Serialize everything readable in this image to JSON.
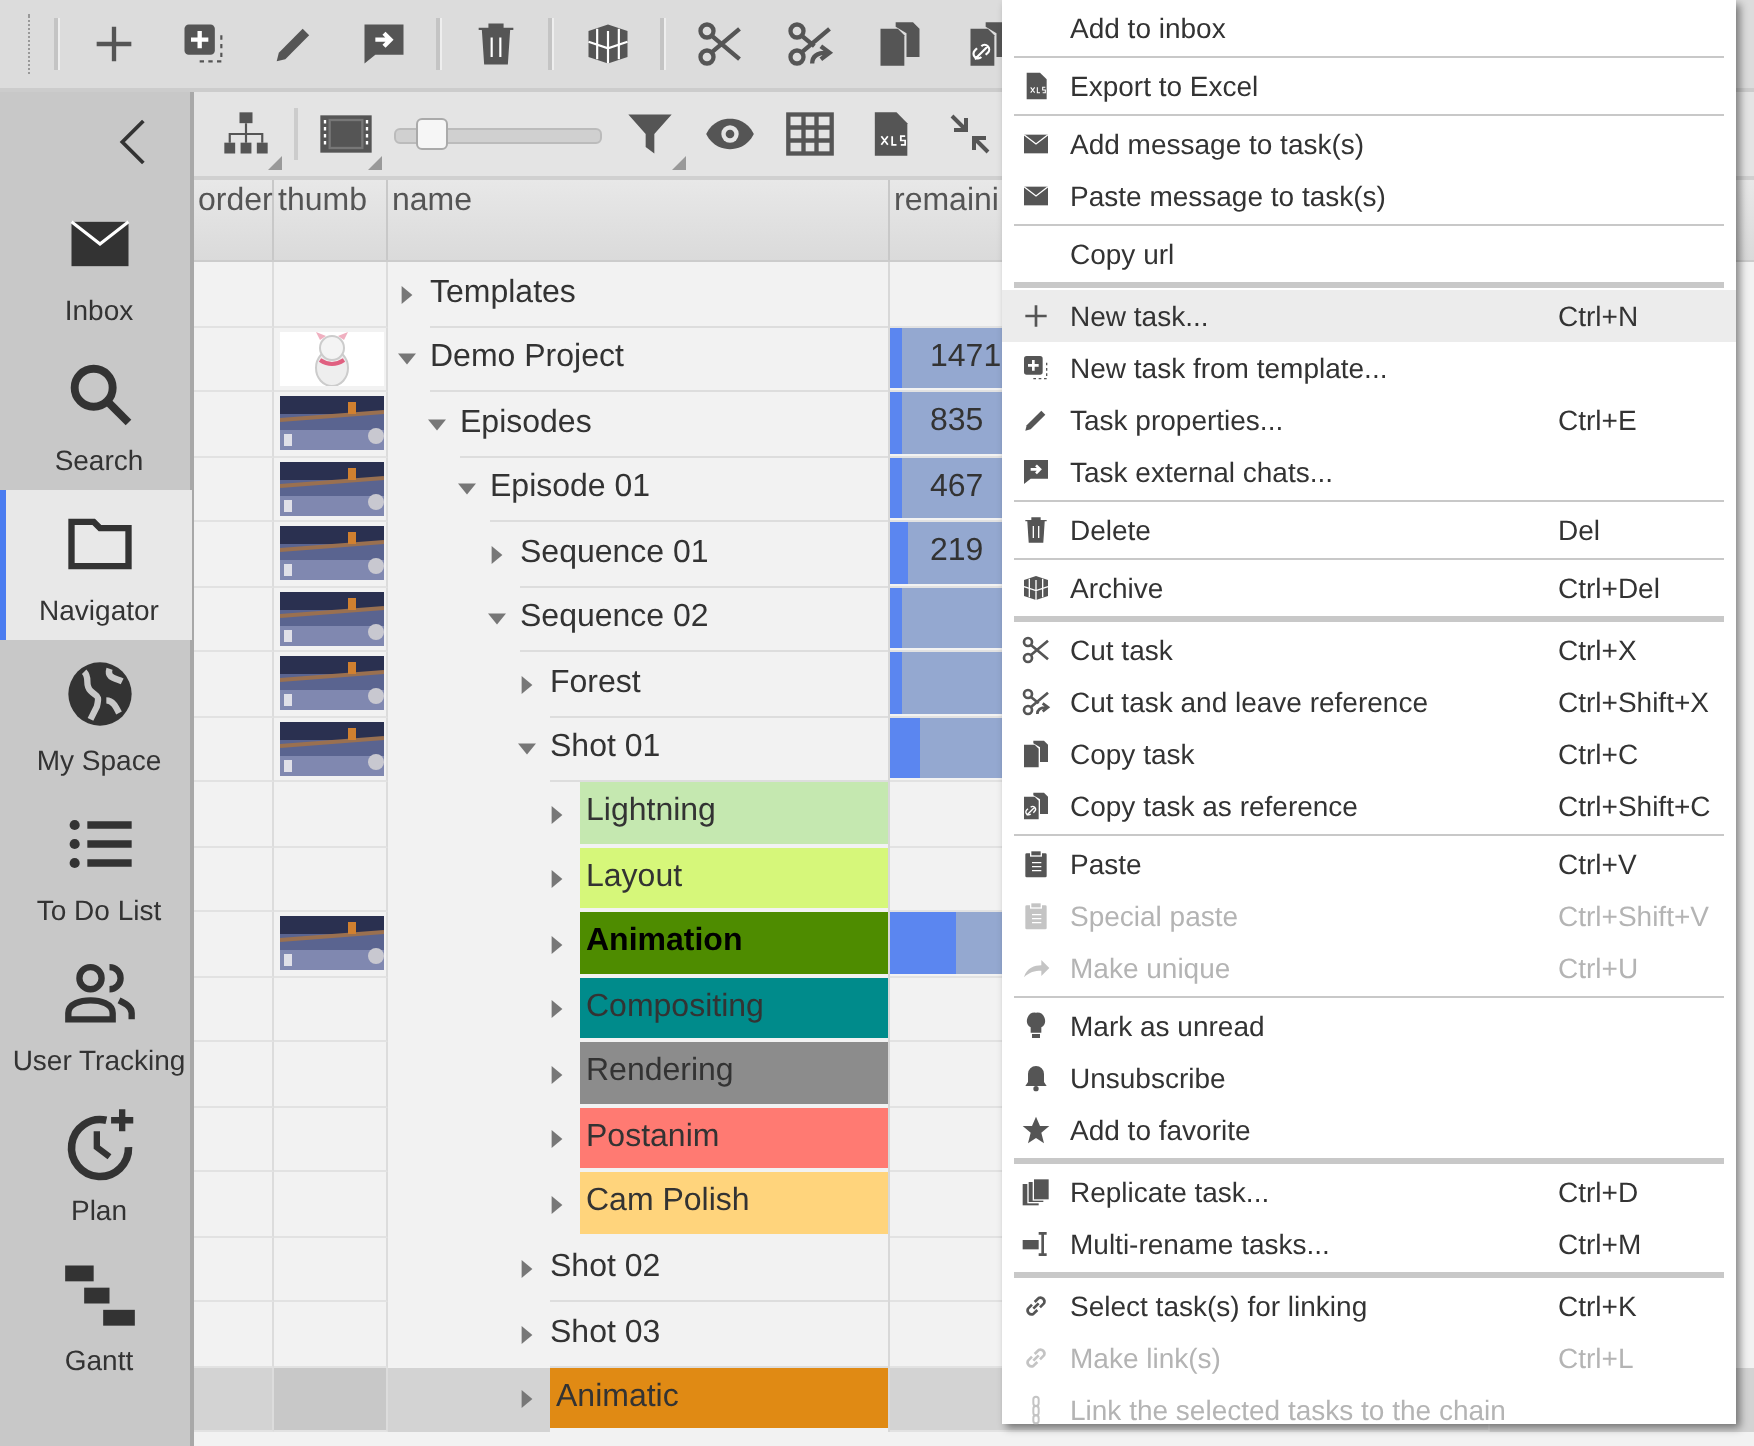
{
  "sidebar": {
    "items": [
      {
        "label": "Inbox",
        "selected": false
      },
      {
        "label": "Search",
        "selected": false
      },
      {
        "label": "Navigator",
        "selected": true
      },
      {
        "label": "My Space",
        "selected": false
      },
      {
        "label": "To Do List",
        "selected": false
      },
      {
        "label": "User Tracking",
        "selected": false
      },
      {
        "label": "Plan",
        "selected": false
      },
      {
        "label": "Gantt",
        "selected": false
      }
    ]
  },
  "view_toolbar": {
    "zoom_slider": {
      "level": 0.12
    }
  },
  "tree": {
    "columns": [
      "order",
      "thumb",
      "name",
      "remaini"
    ],
    "rows": [
      {
        "name": "Templates",
        "expanded": false,
        "selected": false
      },
      {
        "name": "Demo Project",
        "expanded": true,
        "selected": false,
        "thumbnail": {
          "kind": "picture"
        },
        "remaining": "1471",
        "level": 0.02,
        "children": [
          {
            "name": "Episodes",
            "expanded": true,
            "selected": false,
            "thumbnail": {
              "kind": "picture"
            },
            "remaining": "835",
            "level": 0.02,
            "children": [
              {
                "name": "Episode 01",
                "expanded": true,
                "selected": false,
                "thumbnail": {
                  "kind": "picture"
                },
                "remaining": "467",
                "level": 0.02,
                "children": [
                  {
                    "name": "Sequence 01",
                    "expanded": false,
                    "selected": false,
                    "thumbnail": {
                      "kind": "picture"
                    },
                    "remaining": "219",
                    "level": 0.03
                  },
                  {
                    "name": "Sequence 02",
                    "expanded": true,
                    "selected": false,
                    "thumbnail": {
                      "kind": "picture"
                    },
                    "level": 0.02,
                    "children": [
                      {
                        "name": "Forest",
                        "expanded": false,
                        "selected": false,
                        "thumbnail": {
                          "kind": "picture"
                        },
                        "level": 0.02
                      },
                      {
                        "name": "Shot 01",
                        "expanded": true,
                        "selected": false,
                        "thumbnail": {
                          "kind": "picture"
                        },
                        "level": 0.05,
                        "children": [
                          {
                            "name": "Lightning",
                            "expanded": false,
                            "selected": false,
                            "color": "#c5e8b0"
                          },
                          {
                            "name": "Layout",
                            "expanded": false,
                            "selected": false,
                            "color": "#d6f77a"
                          },
                          {
                            "name": "Animation",
                            "expanded": false,
                            "selected": false,
                            "bold": true,
                            "color": "#4e8c00",
                            "thumbnail": {
                              "kind": "picture"
                            },
                            "level": 0.11
                          },
                          {
                            "name": "Compositing",
                            "expanded": false,
                            "selected": false,
                            "color": "#008b8b"
                          },
                          {
                            "name": "Rendering",
                            "expanded": false,
                            "selected": false,
                            "color": "#8c8c8c"
                          },
                          {
                            "name": "Postanim",
                            "expanded": false,
                            "selected": false,
                            "color": "#ff7a72"
                          },
                          {
                            "name": "Cam Polish",
                            "expanded": false,
                            "selected": false,
                            "color": "#ffd47c"
                          }
                        ]
                      },
                      {
                        "name": "Shot 02",
                        "expanded": false,
                        "selected": false
                      },
                      {
                        "name": "Shot 03",
                        "expanded": false,
                        "selected": false
                      },
                      {
                        "name": "Animatic",
                        "expanded": false,
                        "selected": true,
                        "color": "#e08a14"
                      }
                    ]
                  }
                ]
              }
            ]
          }
        ]
      }
    ]
  },
  "context_menu": {
    "groups": [
      [
        {
          "label": "Add to inbox",
          "disabled": false,
          "highlighted": false
        }
      ],
      [
        {
          "label": "Export to Excel",
          "disabled": false,
          "highlighted": false
        }
      ],
      [
        {
          "label": "Add message to task(s)",
          "disabled": false,
          "highlighted": false
        },
        {
          "label": "Paste message to task(s)",
          "disabled": false,
          "highlighted": false
        }
      ],
      [
        {
          "label": "Copy url",
          "disabled": false,
          "highlighted": false
        }
      ],
      [
        {
          "label": "New task...",
          "shortcut": "Ctrl+N",
          "disabled": false,
          "highlighted": true
        },
        {
          "label": "New task from template...",
          "disabled": false,
          "highlighted": false
        },
        {
          "label": "Task properties...",
          "shortcut": "Ctrl+E",
          "disabled": false,
          "highlighted": false
        },
        {
          "label": "Task external chats...",
          "disabled": false,
          "highlighted": false
        }
      ],
      [
        {
          "label": "Delete",
          "shortcut": "Del",
          "disabled": false,
          "highlighted": false
        }
      ],
      [
        {
          "label": "Archive",
          "shortcut": "Ctrl+Del",
          "disabled": false,
          "highlighted": false
        }
      ],
      [
        {
          "label": "Cut task",
          "shortcut": "Ctrl+X",
          "disabled": false,
          "highlighted": false
        },
        {
          "label": "Cut task and leave reference",
          "shortcut": "Ctrl+Shift+X",
          "disabled": false,
          "highlighted": false
        },
        {
          "label": "Copy task",
          "shortcut": "Ctrl+C",
          "disabled": false,
          "highlighted": false
        },
        {
          "label": "Copy task as reference",
          "shortcut": "Ctrl+Shift+C",
          "disabled": false,
          "highlighted": false
        }
      ],
      [
        {
          "label": "Paste",
          "shortcut": "Ctrl+V",
          "disabled": false,
          "highlighted": false
        },
        {
          "label": "Special paste",
          "shortcut": "Ctrl+Shift+V",
          "disabled": true,
          "highlighted": false
        },
        {
          "label": "Make unique",
          "shortcut": "Ctrl+U",
          "disabled": true,
          "highlighted": false
        }
      ],
      [
        {
          "label": "Mark as unread",
          "disabled": false,
          "highlighted": false
        },
        {
          "label": "Unsubscribe",
          "disabled": false,
          "highlighted": false
        },
        {
          "label": "Add to favorite",
          "disabled": false,
          "highlighted": false
        }
      ],
      [
        {
          "label": "Replicate task...",
          "shortcut": "Ctrl+D",
          "disabled": false,
          "highlighted": false
        },
        {
          "label": "Multi-rename tasks...",
          "shortcut": "Ctrl+M",
          "disabled": false,
          "highlighted": false
        }
      ],
      [
        {
          "label": "Select task(s) for linking",
          "shortcut": "Ctrl+K",
          "disabled": false,
          "highlighted": false
        },
        {
          "label": "Make link(s)",
          "shortcut": "Ctrl+L",
          "disabled": true,
          "highlighted": false
        },
        {
          "label": "Link the selected tasks to the chain",
          "disabled": true,
          "highlighted": false
        }
      ]
    ]
  }
}
